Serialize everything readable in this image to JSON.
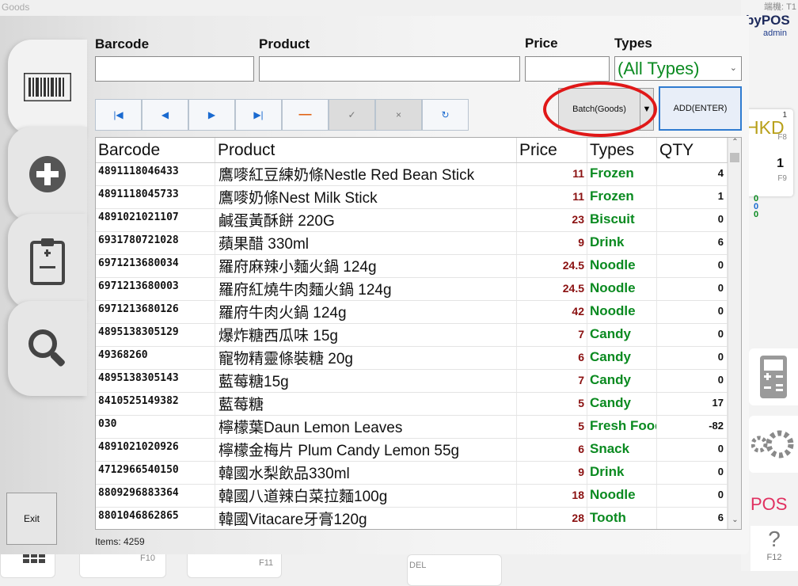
{
  "window": {
    "title": "Goods"
  },
  "background": {
    "corner_tag": "端機: T1",
    "brand": "byPOS",
    "user": "admin",
    "hkd": "HKD",
    "hkd_count_small": "1",
    "hkd_count_big": "1",
    "f8": "F8",
    "f9": "F9",
    "stats": [
      "0",
      "0",
      "0"
    ],
    "pos_text": "POS",
    "help_key": "F12",
    "bottom_keys": [
      "F10",
      "F11",
      "DEL"
    ]
  },
  "filters": {
    "barcode_label": "Barcode",
    "product_label": "Product",
    "price_label": "Price",
    "types_label": "Types",
    "types_selected": "(All Types)",
    "barcode_value": "",
    "product_value": "",
    "price_value": ""
  },
  "toolbar": {
    "batch_label": "Batch(Goods)",
    "add_label": "ADD(ENTER)"
  },
  "table": {
    "headers": [
      "Barcode",
      "Product",
      "Price",
      "Types",
      "QTY"
    ],
    "rows": [
      {
        "barcode": "4891118046433",
        "product": "鷹嘜紅豆練奶條Nestle Red Bean Stick",
        "price": "11",
        "type": "Frozen",
        "qty": "4"
      },
      {
        "barcode": "4891118045733",
        "product": "鷹嘜奶條Nest Milk Stick",
        "price": "11",
        "type": "Frozen",
        "qty": "1"
      },
      {
        "barcode": "4891021021107",
        "product": "鹹蛋黃酥餅 220G",
        "price": "23",
        "type": "Biscuit",
        "qty": "0"
      },
      {
        "barcode": "6931780721028",
        "product": "蘋果醋 330ml",
        "price": "9",
        "type": "Drink",
        "qty": "6"
      },
      {
        "barcode": "6971213680034",
        "product": "羅府麻辣小麵火鍋 124g",
        "price": "24.5",
        "type": "Noodle",
        "qty": "0"
      },
      {
        "barcode": "6971213680003",
        "product": "羅府紅燒牛肉麵火鍋 124g",
        "price": "24.5",
        "type": "Noodle",
        "qty": "0"
      },
      {
        "barcode": "6971213680126",
        "product": "羅府牛肉火鍋 124g",
        "price": "42",
        "type": "Noodle",
        "qty": "0"
      },
      {
        "barcode": "4895138305129",
        "product": "爆炸糖西瓜味 15g",
        "price": "7",
        "type": "Candy",
        "qty": "0"
      },
      {
        "barcode": "49368260",
        "product": "寵物精靈條裝糖 20g",
        "price": "6",
        "type": "Candy",
        "qty": "0"
      },
      {
        "barcode": "4895138305143",
        "product": "藍莓糖15g",
        "price": "7",
        "type": "Candy",
        "qty": "0"
      },
      {
        "barcode": "8410525149382",
        "product": "藍莓糖",
        "price": "5",
        "type": "Candy",
        "qty": "17"
      },
      {
        "barcode": "030",
        "product": "檸檬葉Daun Lemon Leaves",
        "price": "5",
        "type": "Fresh Food",
        "qty": "-82"
      },
      {
        "barcode": "4891021020926",
        "product": "檸檬金梅片 Plum Candy Lemon 55g",
        "price": "6",
        "type": "Snack",
        "qty": "0"
      },
      {
        "barcode": "4712966540150",
        "product": "韓國水梨飲品330ml",
        "price": "9",
        "type": "Drink",
        "qty": "0"
      },
      {
        "barcode": "8809296883364",
        "product": "韓國八道辣白菜拉麵100g",
        "price": "18",
        "type": "Noodle",
        "qty": "0"
      },
      {
        "barcode": "8801046862865",
        "product": "韓國Vitacare牙膏120g",
        "price": "28",
        "type": "Tooth",
        "qty": "6"
      }
    ]
  },
  "footer": {
    "items_count": "Items: 4259",
    "exit_label": "Exit"
  },
  "colors": {
    "type_green": "#0a8a20",
    "price_red": "#8a1010",
    "accent_blue": "#2f7bd0",
    "highlight_red": "#e01818"
  }
}
